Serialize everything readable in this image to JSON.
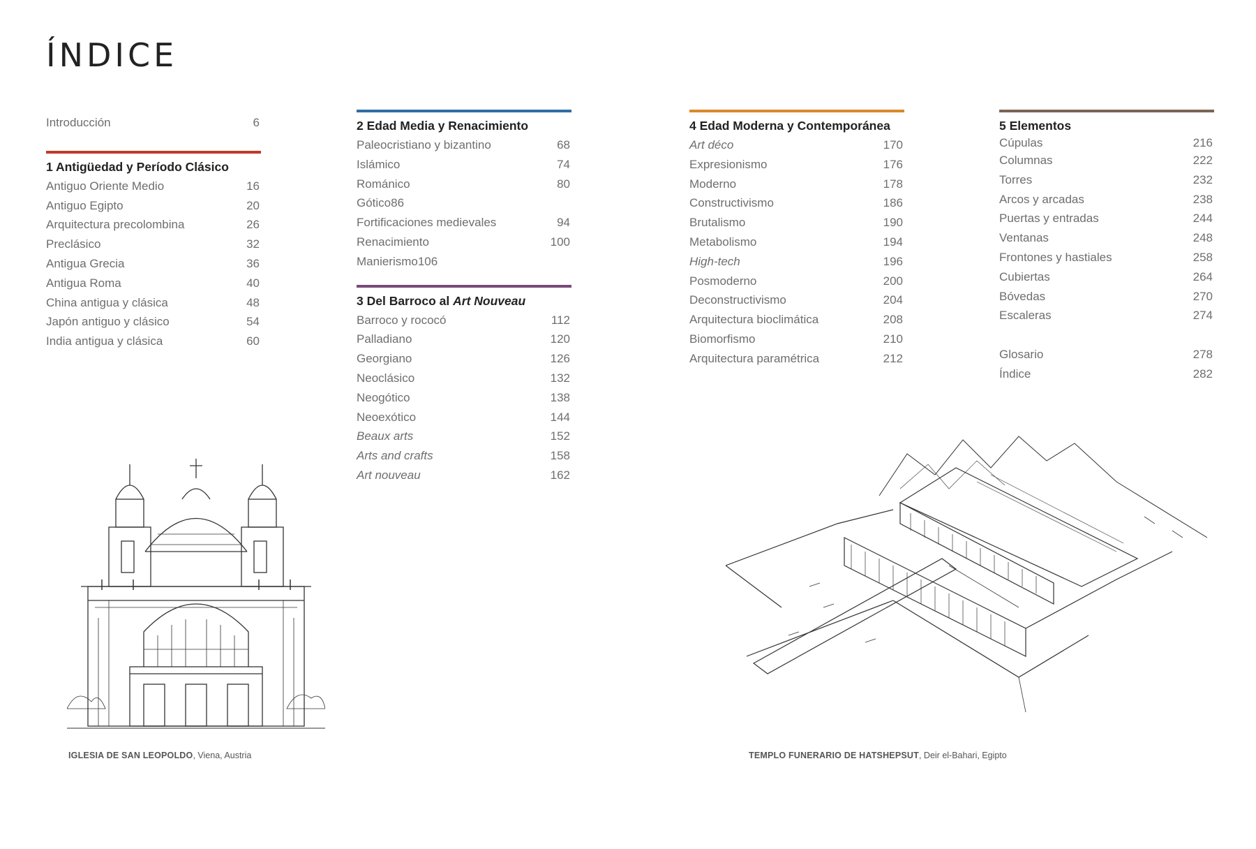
{
  "page": {
    "title": "ÍNDICE"
  },
  "colors": {
    "section1": "#c0392b",
    "section2": "#2e6da4",
    "section3": "#7a4a78",
    "section4": "#d98a2b",
    "section5": "#7d6553"
  },
  "intro": {
    "label": "Introducción",
    "page": "6"
  },
  "sections": [
    {
      "heading": "1 Antigüedad y Período Clásico",
      "entries": [
        {
          "label": "Antiguo Oriente Medio",
          "page": "16"
        },
        {
          "label": "Antiguo Egipto",
          "page": "20"
        },
        {
          "label": "Arquitectura precolombina",
          "page": "26"
        },
        {
          "label": "Preclásico",
          "page": "32"
        },
        {
          "label": "Antigua Grecia",
          "page": "36"
        },
        {
          "label": "Antigua Roma",
          "page": "40"
        },
        {
          "label": "China antigua y clásica",
          "page": "48"
        },
        {
          "label": "Japón antiguo y clásico",
          "page": "54"
        },
        {
          "label": "India antigua y clásica",
          "page": "60"
        }
      ]
    },
    {
      "heading": "2 Edad Media y Renacimiento",
      "entries": [
        {
          "label": "Paleocristiano y bizantino",
          "page": "68"
        },
        {
          "label": "Islámico",
          "page": "74"
        },
        {
          "label": "Románico",
          "page": "80"
        },
        {
          "label": "Gótico86",
          "page": ""
        },
        {
          "label": "Fortificaciones medievales",
          "page": "94"
        },
        {
          "label": "Renacimiento",
          "page": "100"
        },
        {
          "label": "Manierismo106",
          "page": ""
        }
      ]
    },
    {
      "heading_plain": "3 Del Barroco al ",
      "heading_italic": "Art Nouveau",
      "entries": [
        {
          "label": "Barroco y rococó",
          "page": "112"
        },
        {
          "label": "Palladiano",
          "page": "120"
        },
        {
          "label": "Georgiano",
          "page": "126"
        },
        {
          "label": "Neoclásico",
          "page": "132"
        },
        {
          "label": "Neogótico",
          "page": "138"
        },
        {
          "label": "Neoexótico",
          "page": "144"
        },
        {
          "label": "Beaux arts",
          "page": "152"
        },
        {
          "label": "Arts and crafts",
          "page": "158"
        },
        {
          "label": "Art nouveau",
          "page": "162"
        }
      ]
    },
    {
      "heading": "4 Edad Moderna y Contemporánea",
      "entries": [
        {
          "label": "Art déco",
          "page": "170"
        },
        {
          "label": "Expresionismo",
          "page": "176"
        },
        {
          "label": "Moderno",
          "page": "178"
        },
        {
          "label": "Constructivismo",
          "page": "186"
        },
        {
          "label": "Brutalismo",
          "page": "190"
        },
        {
          "label": "Metabolismo",
          "page": "194"
        },
        {
          "label": "High-tech",
          "page": "196"
        },
        {
          "label": "Posmoderno",
          "page": "200"
        },
        {
          "label": "Deconstructivismo",
          "page": "204"
        },
        {
          "label": "Arquitectura bioclimática",
          "page": "208"
        },
        {
          "label": "Biomorfismo",
          "page": "210"
        },
        {
          "label": "Arquitectura paramétrica",
          "page": "212"
        }
      ]
    },
    {
      "heading": "5 Elementos",
      "entries": [
        {
          "label": "Cúpulas",
          "page": "216"
        },
        {
          "label": "Columnas",
          "page": "222"
        },
        {
          "label": "Torres",
          "page": "232"
        },
        {
          "label": "Arcos y arcadas",
          "page": "238"
        },
        {
          "label": "Puertas y entradas",
          "page": "244"
        },
        {
          "label": "Ventanas",
          "page": "248"
        },
        {
          "label": "Frontones y hastiales",
          "page": "258"
        },
        {
          "label": "Cubiertas",
          "page": "264"
        },
        {
          "label": "Bóvedas",
          "page": "270"
        },
        {
          "label": "Escaleras",
          "page": "274"
        }
      ]
    }
  ],
  "appendix": [
    {
      "label": "Glosario",
      "page": "278"
    },
    {
      "label": "Índice",
      "page": "282"
    }
  ],
  "captions": {
    "church_name": "IGLESIA DE SAN LEOPOLDO",
    "church_place": ", Viena, Austria",
    "temple_name": "TEMPLO FUNERARIO DE HATSHEPSUT",
    "temple_place": ", Deir el-Bahari, Egipto"
  }
}
